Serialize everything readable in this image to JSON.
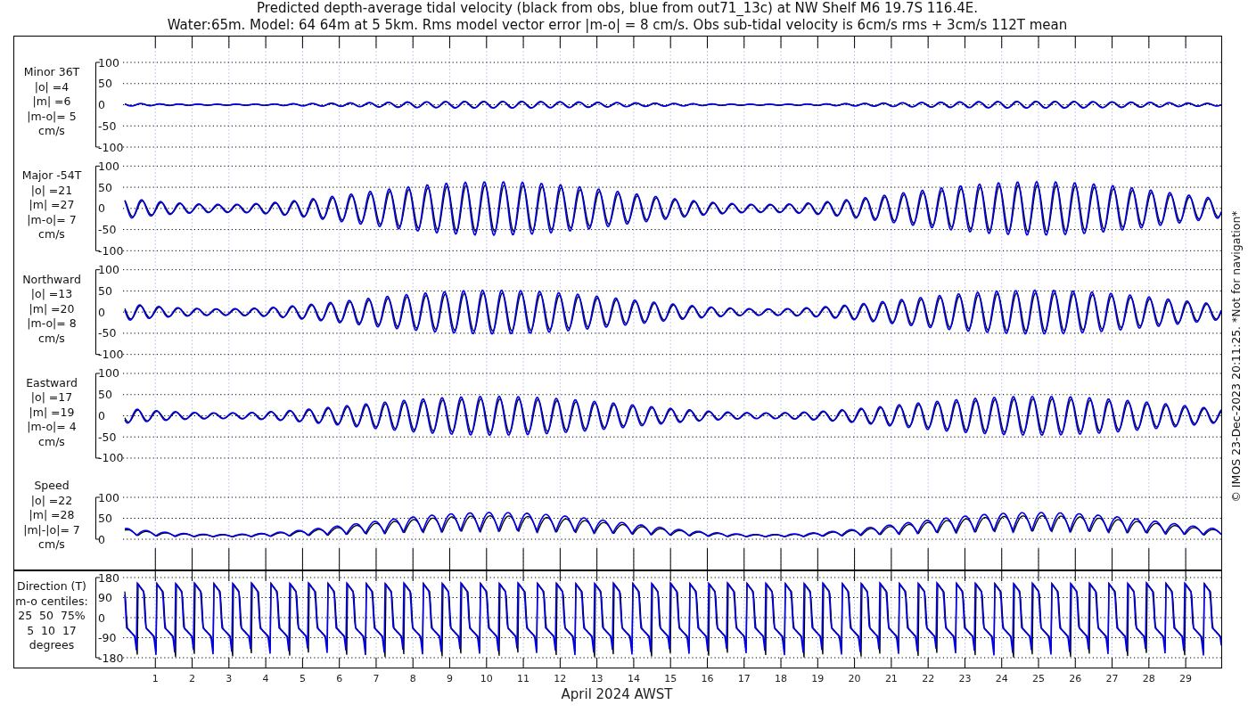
{
  "title": {
    "line_1": "Predicted depth-average tidal velocity (black from obs, blue from out71_13c) at NW Shelf M6 19.7S 116.4E.",
    "line_2": "Water:65m. Model: 64 64m at 5 5km. Rms model vector error |m-o| = 8 cm/s. Obs sub-tidal velocity is 6cm/s rms + 3cm/s 112T mean"
  },
  "panels": [
    {
      "kind": "velocity",
      "label_lines": [
        "Minor 36T",
        "|o| =4",
        "|m| =6",
        "|m-o|= 5",
        "cm/s"
      ],
      "yticks": [
        "100",
        "50",
        "0",
        "-50",
        "-100"
      ]
    },
    {
      "kind": "velocity",
      "label_lines": [
        "Major -54T",
        "|o| =21",
        "|m| =27",
        "|m-o|= 7",
        "cm/s"
      ],
      "yticks": [
        "100",
        "50",
        "0",
        "-50",
        "-100"
      ]
    },
    {
      "kind": "velocity",
      "label_lines": [
        "Northward",
        "|o| =13",
        "|m| =20",
        "|m-o|= 8",
        "cm/s"
      ],
      "yticks": [
        "100",
        "50",
        "0",
        "-50",
        "-100"
      ]
    },
    {
      "kind": "velocity",
      "label_lines": [
        "Eastward",
        "|o| =17",
        "|m| =19",
        "|m-o|= 4",
        "cm/s"
      ],
      "yticks": [
        "100",
        "50",
        "0",
        "-50",
        "-100"
      ]
    },
    {
      "kind": "speed",
      "label_lines": [
        "Speed",
        "|o| =22",
        "|m| =28",
        "|m|-|o|= 7",
        "cm/s"
      ],
      "yticks": [
        "100",
        "50",
        "0"
      ]
    },
    {
      "kind": "direction",
      "label_lines": [
        "Direction (T)",
        "m-o centiles:",
        "25  50  75%",
        "5  10  17",
        "degrees"
      ],
      "yticks": [
        "180",
        "90",
        "0",
        "-90",
        "-180"
      ]
    }
  ],
  "x_axis": {
    "day_labels": [
      "1",
      "2",
      "3",
      "4",
      "5",
      "6",
      "7",
      "8",
      "9",
      "10",
      "11",
      "12",
      "13",
      "14",
      "15",
      "16",
      "17",
      "18",
      "19",
      "20",
      "21",
      "22",
      "23",
      "24",
      "25",
      "26",
      "27",
      "28",
      "29"
    ],
    "label": "April 2024 AWST"
  },
  "side_note": "© IMOS 23-Dec-2023 20:11:25. *Not for navigation*"
}
